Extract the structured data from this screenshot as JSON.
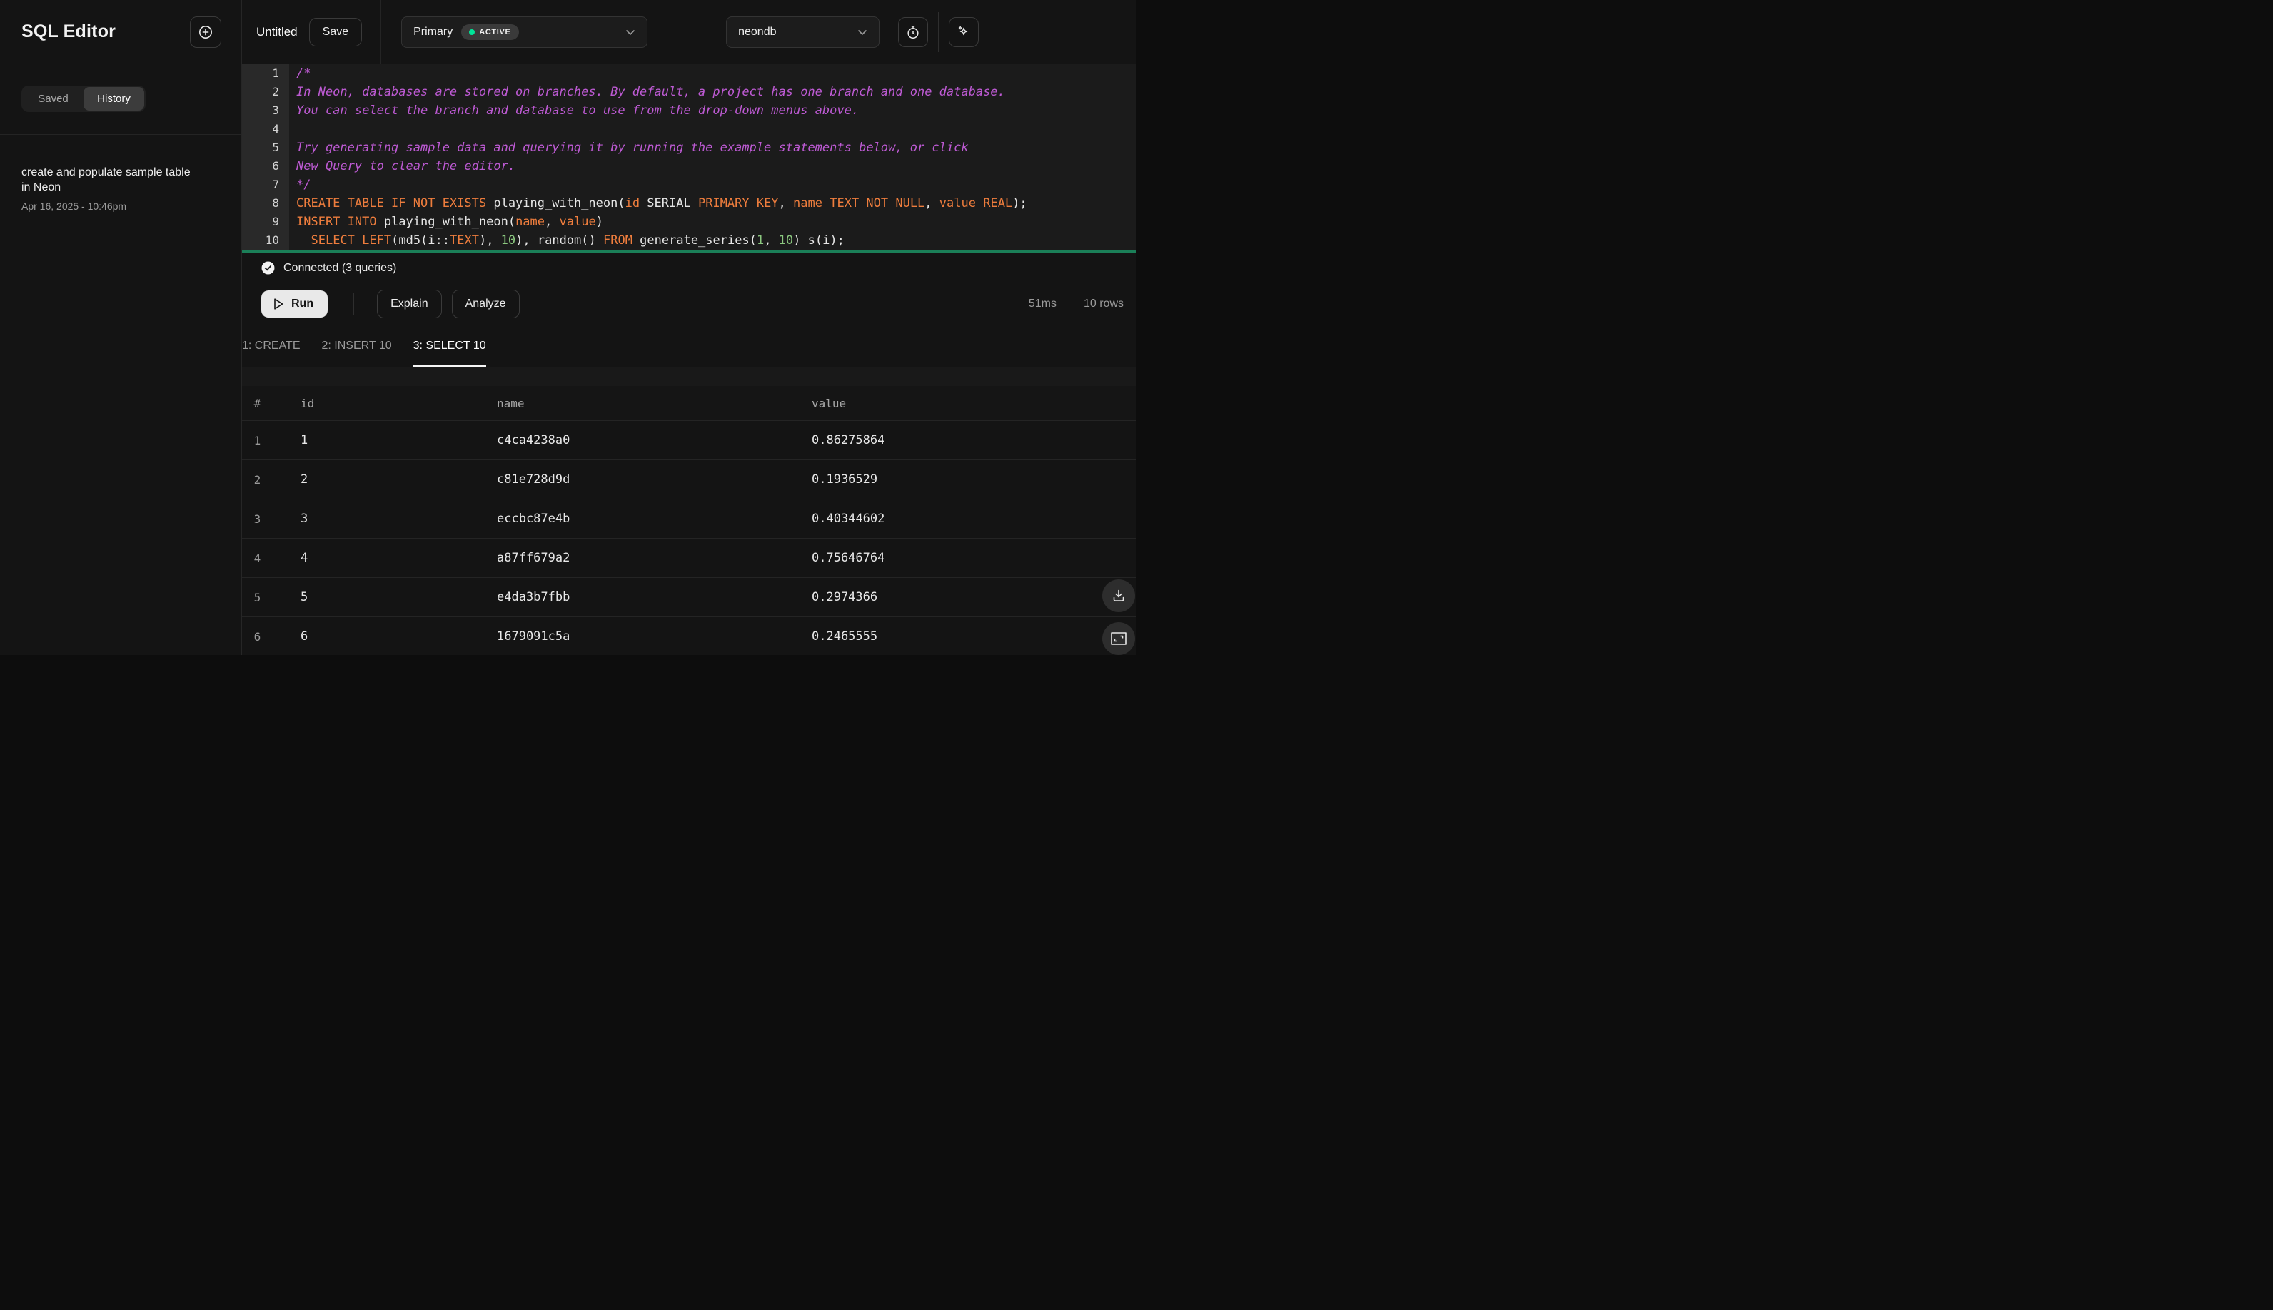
{
  "app": {
    "title": "SQL Editor"
  },
  "sidebar": {
    "tabs": [
      {
        "label": "Saved",
        "active": false
      },
      {
        "label": "History",
        "active": true
      }
    ],
    "history": [
      {
        "title": "create and populate sample table in Neon",
        "timestamp": "Apr 16, 2025 - 10:46pm"
      }
    ]
  },
  "topbar": {
    "query_name": "Untitled",
    "save_label": "Save",
    "branch": {
      "name": "Primary",
      "status": "ACTIVE",
      "status_color": "#00e599"
    },
    "database": {
      "name": "neondb"
    }
  },
  "editor": {
    "lines": [
      {
        "segments": [
          {
            "c": "comment",
            "t": "/*"
          }
        ]
      },
      {
        "segments": [
          {
            "c": "comment",
            "t": "In Neon, databases are stored on branches. By default, a project has one branch and one database."
          }
        ]
      },
      {
        "segments": [
          {
            "c": "comment",
            "t": "You can select the branch and database to use from the drop-down menus above."
          }
        ]
      },
      {
        "segments": []
      },
      {
        "segments": [
          {
            "c": "comment",
            "t": "Try generating sample data and querying it by running the example statements below, or click"
          }
        ]
      },
      {
        "segments": [
          {
            "c": "comment",
            "t": "New Query to clear the editor."
          }
        ]
      },
      {
        "segments": [
          {
            "c": "comment",
            "t": "*/"
          }
        ]
      },
      {
        "segments": [
          {
            "c": "kw",
            "t": "CREATE TABLE IF NOT EXISTS"
          },
          {
            "c": "plain",
            "t": " playing_with_neon("
          },
          {
            "c": "kw",
            "t": "id"
          },
          {
            "c": "plain",
            "t": " SERIAL "
          },
          {
            "c": "kw",
            "t": "PRIMARY KEY"
          },
          {
            "c": "plain",
            "t": ", "
          },
          {
            "c": "kw",
            "t": "name"
          },
          {
            "c": "plain",
            "t": " "
          },
          {
            "c": "kw",
            "t": "TEXT NOT NULL"
          },
          {
            "c": "plain",
            "t": ", "
          },
          {
            "c": "kw",
            "t": "value"
          },
          {
            "c": "plain",
            "t": " "
          },
          {
            "c": "kw",
            "t": "REAL"
          },
          {
            "c": "plain",
            "t": ");"
          }
        ]
      },
      {
        "segments": [
          {
            "c": "kw",
            "t": "INSERT INTO"
          },
          {
            "c": "plain",
            "t": " playing_with_neon("
          },
          {
            "c": "kw",
            "t": "name"
          },
          {
            "c": "plain",
            "t": ", "
          },
          {
            "c": "kw",
            "t": "value"
          },
          {
            "c": "plain",
            "t": ")"
          }
        ]
      },
      {
        "segments": [
          {
            "c": "plain",
            "t": "  "
          },
          {
            "c": "kw",
            "t": "SELECT"
          },
          {
            "c": "plain",
            "t": " "
          },
          {
            "c": "kw",
            "t": "LEFT"
          },
          {
            "c": "plain",
            "t": "(md5(i::"
          },
          {
            "c": "kw",
            "t": "TEXT"
          },
          {
            "c": "plain",
            "t": "), "
          },
          {
            "c": "num",
            "t": "10"
          },
          {
            "c": "plain",
            "t": "), random() "
          },
          {
            "c": "kw",
            "t": "FROM"
          },
          {
            "c": "plain",
            "t": " generate_series("
          },
          {
            "c": "num",
            "t": "1"
          },
          {
            "c": "plain",
            "t": ", "
          },
          {
            "c": "num",
            "t": "10"
          },
          {
            "c": "plain",
            "t": ") s(i);"
          }
        ]
      }
    ]
  },
  "status_bar": {
    "text": "Connected (3 queries)"
  },
  "toolbar": {
    "run": "Run",
    "explain": "Explain",
    "analyze": "Analyze",
    "duration": "51ms",
    "row_count": "10 rows"
  },
  "results": {
    "tabs": [
      {
        "label": "1: CREATE",
        "active": false
      },
      {
        "label": "2: INSERT 10",
        "active": false
      },
      {
        "label": "3: SELECT 10",
        "active": true
      }
    ],
    "table": {
      "headers": [
        "#",
        "id",
        "name",
        "value"
      ],
      "rows": [
        [
          "1",
          "1",
          "c4ca4238a0",
          "0.86275864"
        ],
        [
          "2",
          "2",
          "c81e728d9d",
          "0.1936529"
        ],
        [
          "3",
          "3",
          "eccbc87e4b",
          "0.40344602"
        ],
        [
          "4",
          "4",
          "a87ff679a2",
          "0.75646764"
        ],
        [
          "5",
          "5",
          "e4da3b7fbb",
          "0.2974366"
        ],
        [
          "6",
          "6",
          "1679091c5a",
          "0.2465555"
        ]
      ]
    }
  },
  "colors": {
    "accent_green": "#00e599",
    "statement_bar_green": "#1b7f58",
    "keyword_orange": "#ee7d3d",
    "comment_purple": "#bd5ad3",
    "number_green": "#8bc87f"
  }
}
